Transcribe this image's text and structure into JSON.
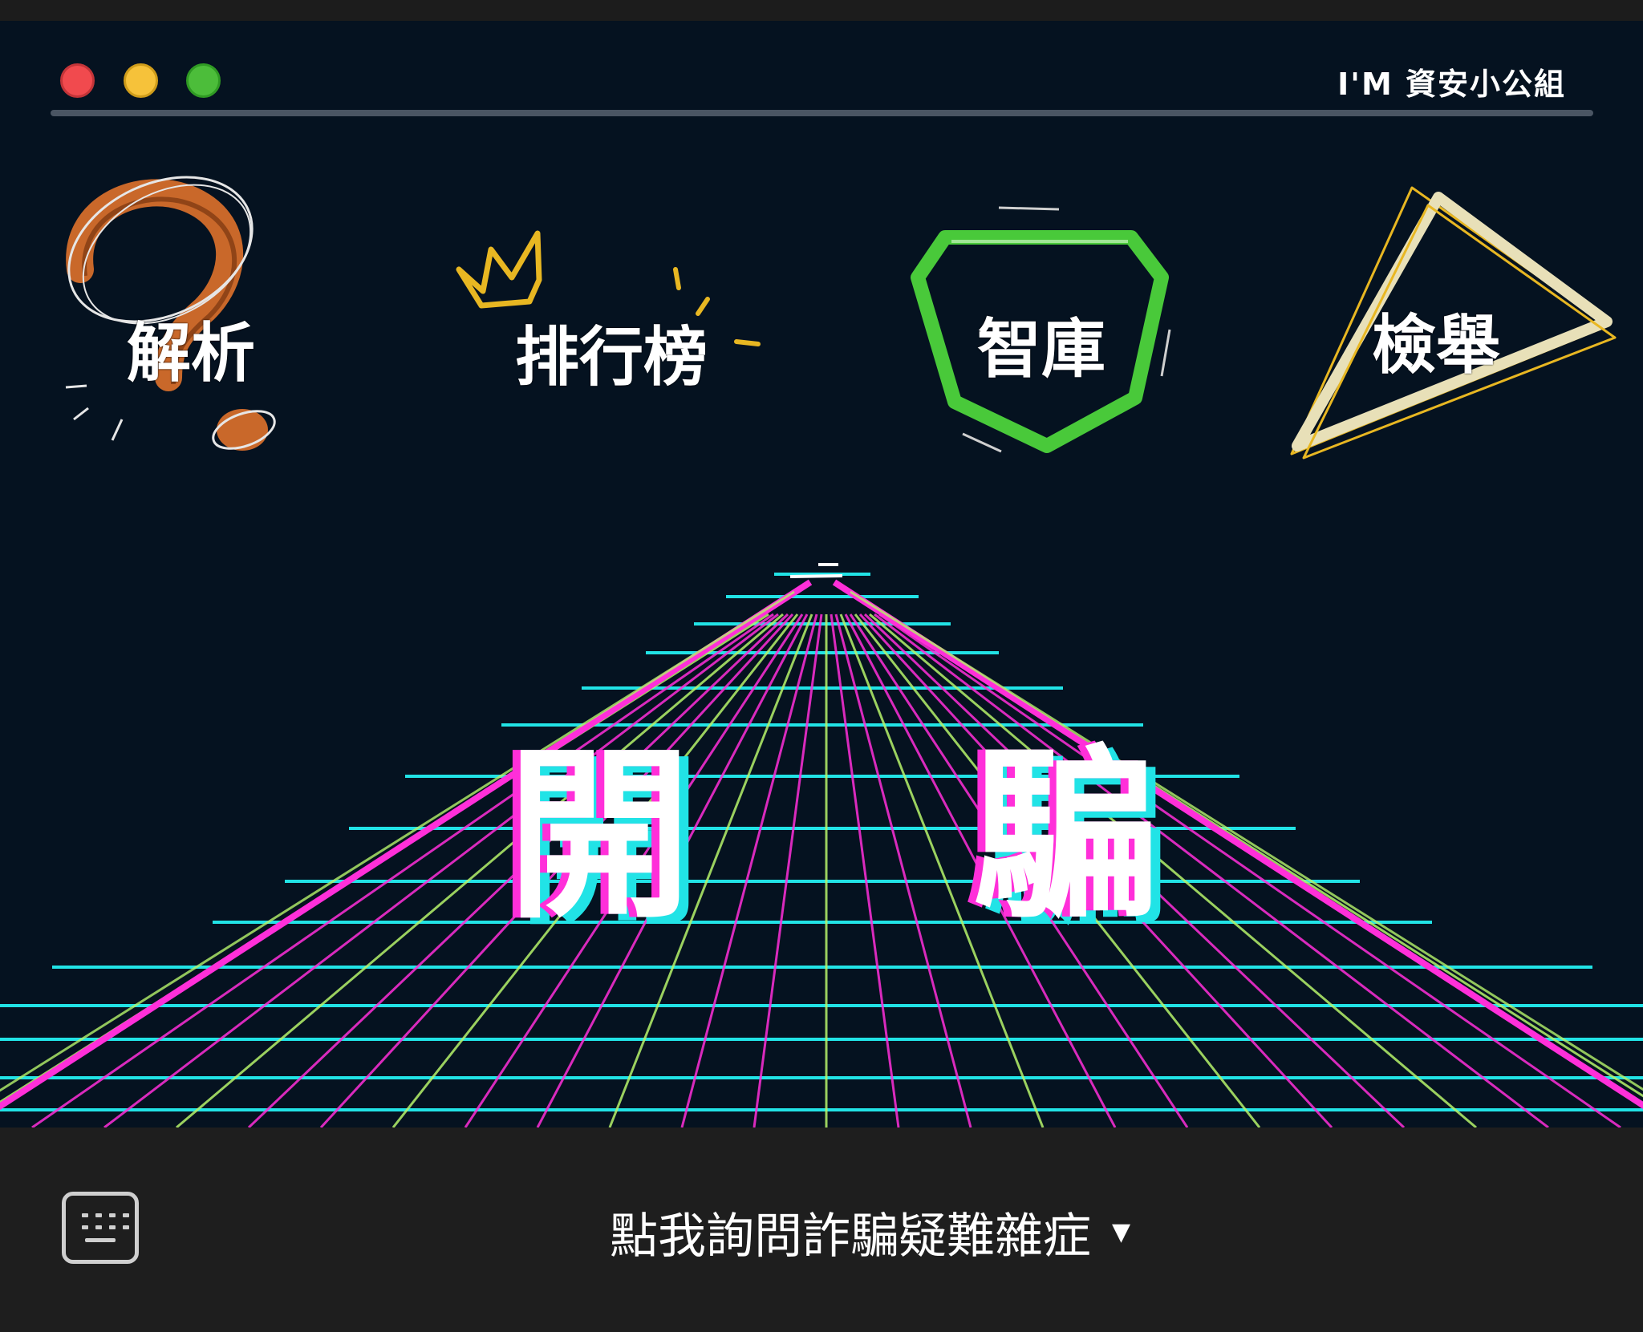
{
  "window": {
    "title": "I'M 資安小公組"
  },
  "nav": {
    "analysis_label": "解析",
    "ranking_label": "排行榜",
    "library_label": "智庫",
    "report_label": "檢舉"
  },
  "hero": {
    "char_1": "開",
    "char_2": "騙"
  },
  "bottom_bar": {
    "menu_label": "點我詢問詐騙疑難雜症",
    "menu_caret": "▼"
  },
  "colors": {
    "background": "#051220",
    "grid_cyan": "#21e3e6",
    "grid_magenta": "#ff2fd9",
    "grid_lime": "#b6f36b",
    "analysis_accent": "#c9682a",
    "crown_accent": "#e8b722",
    "library_accent": "#49c93a",
    "report_accent": "#e8e0b8"
  },
  "icons": {
    "analysis": "question-mark-icon",
    "ranking": "crown-icon",
    "library": "shield-icon",
    "report": "triangle-icon",
    "keyboard": "keyboard-icon",
    "caret": "caret-down-icon"
  }
}
